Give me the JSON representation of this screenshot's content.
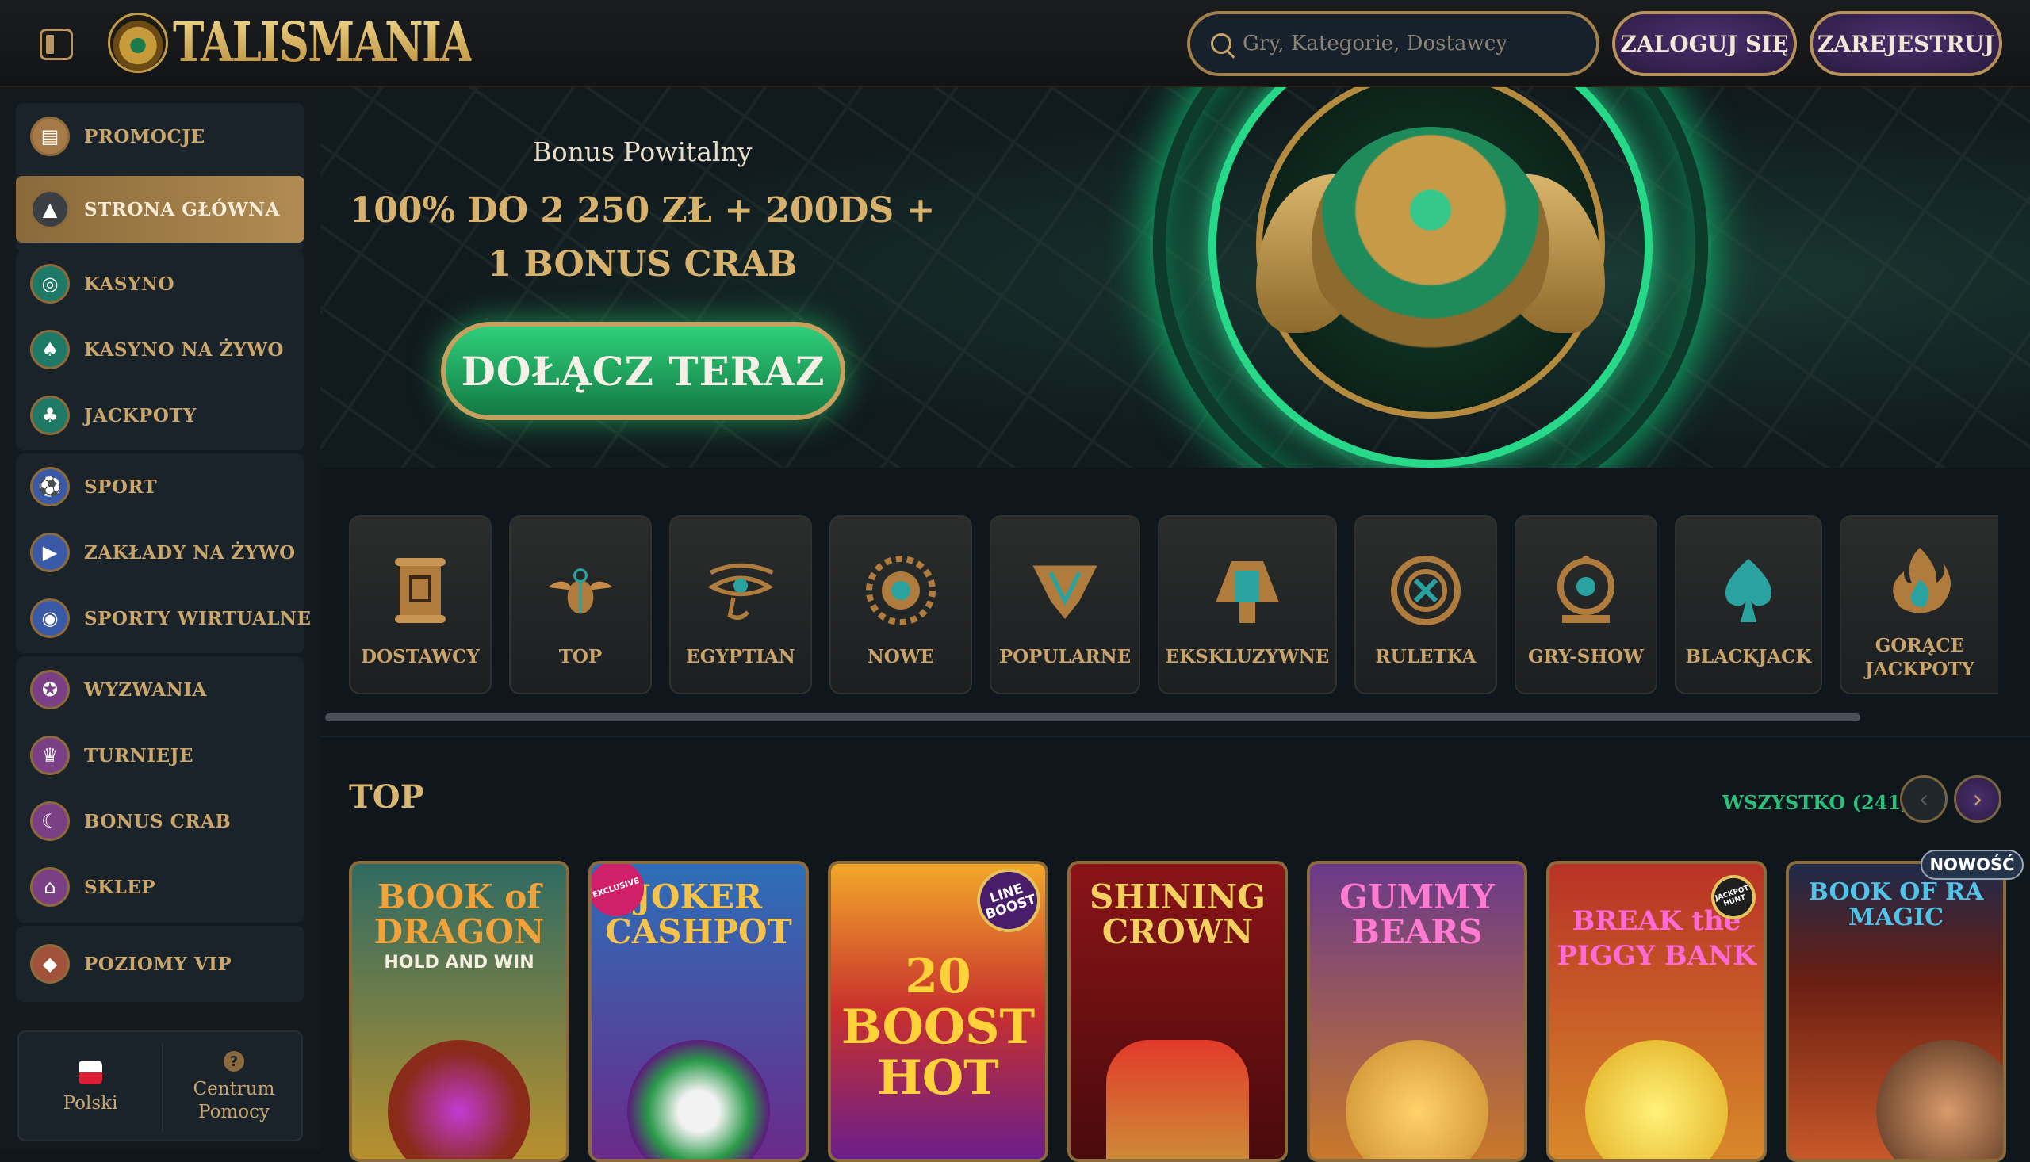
{
  "header": {
    "logo_text": "TALISMANIA",
    "search_placeholder": "Gry, Kategorie, Dostawcy",
    "login_label": "ZALOGUJ SIĘ",
    "register_label": "ZAREJESTRUJ"
  },
  "sidebar": {
    "items": [
      {
        "label": "PROMOCJE",
        "icon": "gift-box-icon",
        "color": "#a77b48"
      },
      {
        "label": "STRONA GŁÓWNA",
        "icon": "pyramid-icon",
        "color": "#3b3f44",
        "active": true
      },
      {
        "label": "KASYNO",
        "icon": "chip-icon",
        "color": "#1e7a66"
      },
      {
        "label": "KASYNO NA ŻYWO",
        "icon": "spade-icon",
        "color": "#1e7a66"
      },
      {
        "label": "JACKPOTY",
        "icon": "clover-icon",
        "color": "#1e7a66"
      },
      {
        "label": "SPORT",
        "icon": "ball-icon",
        "color": "#3a5aa8"
      },
      {
        "label": "ZAKŁADY NA ŻYWO",
        "icon": "play-icon",
        "color": "#3a5aa8"
      },
      {
        "label": "SPORTY WIRTUALNE",
        "icon": "gamepad-icon",
        "color": "#3a5aa8"
      },
      {
        "label": "WYZWANIA",
        "icon": "target-icon",
        "color": "#7b3f86"
      },
      {
        "label": "TURNIEJE",
        "icon": "trophy-icon",
        "color": "#7b3f86"
      },
      {
        "label": "BONUS CRAB",
        "icon": "claw-icon",
        "color": "#7b3f86"
      },
      {
        "label": "SKLEP",
        "icon": "shop-icon",
        "color": "#7b3f86"
      },
      {
        "label": "POZIOMY VIP",
        "icon": "diamond-icon",
        "color": "#a1523a"
      }
    ],
    "footer": {
      "language": "Polski",
      "help": "Centrum Pomocy",
      "help_glyph": "?"
    }
  },
  "banner": {
    "subtitle": "Bonus Powitalny",
    "headline_line1": "100% DO 2 250 ZŁ + 200DS +",
    "headline_line2": "1 BONUS CRAB",
    "cta": "DOŁĄCZ TERAZ"
  },
  "categories": [
    {
      "label": "DOSTAWCY",
      "icon": "scroll-icon"
    },
    {
      "label": "TOP",
      "icon": "scarab-icon"
    },
    {
      "label": "EGYPTIAN",
      "icon": "eye-of-horus-icon"
    },
    {
      "label": "NOWE",
      "icon": "sun-disc-icon"
    },
    {
      "label": "POPULARNE",
      "icon": "crown-icon"
    },
    {
      "label": "EKSKLUZYWNE",
      "icon": "pharaoh-icon"
    },
    {
      "label": "RULETKA",
      "icon": "roulette-icon"
    },
    {
      "label": "GRY-SHOW",
      "icon": "wheel-icon"
    },
    {
      "label": "BLACKJACK",
      "icon": "spade-icon"
    },
    {
      "label": "GORĄCE JACKPOTY",
      "icon": "flame-icon"
    }
  ],
  "games_section": {
    "title": "TOP",
    "see_all": "WSZYSTKO (241)",
    "prev": "‹",
    "next": "›",
    "new_badge": "NOWOŚĆ",
    "games": [
      {
        "title": "BOOK of DRAGON",
        "sub": "HOLD AND WIN",
        "bg": "#2f6b62",
        "title_color": "#f2a23a"
      },
      {
        "title": "JOKER CASHPOT",
        "sub": "",
        "bg": "#2d6fb8",
        "title_color": "#f6c34a",
        "badge": "EXCLUSIVE"
      },
      {
        "title": "20 BOOST HOT",
        "sub": "",
        "bg": "#c84a2e",
        "title_color": "#ffd23a",
        "badge": "LINE BOOST"
      },
      {
        "title": "SHINING CROWN",
        "sub": "",
        "bg": "#8a1418",
        "title_color": "#f4d060"
      },
      {
        "title": "GUMMY BEARS",
        "sub": "",
        "bg": "#a2552a",
        "title_color": "#ff7ad0"
      },
      {
        "title": "BREAK the PIGGY BANK",
        "sub": "",
        "bg": "#b83226",
        "title_color": "#ff6ad6",
        "badge": "JACKPOT HUNT"
      },
      {
        "title": "BOOK OF RA MAGIC",
        "sub": "",
        "bg": "#6a1e12",
        "title_color": "#4fc3e8"
      }
    ]
  }
}
